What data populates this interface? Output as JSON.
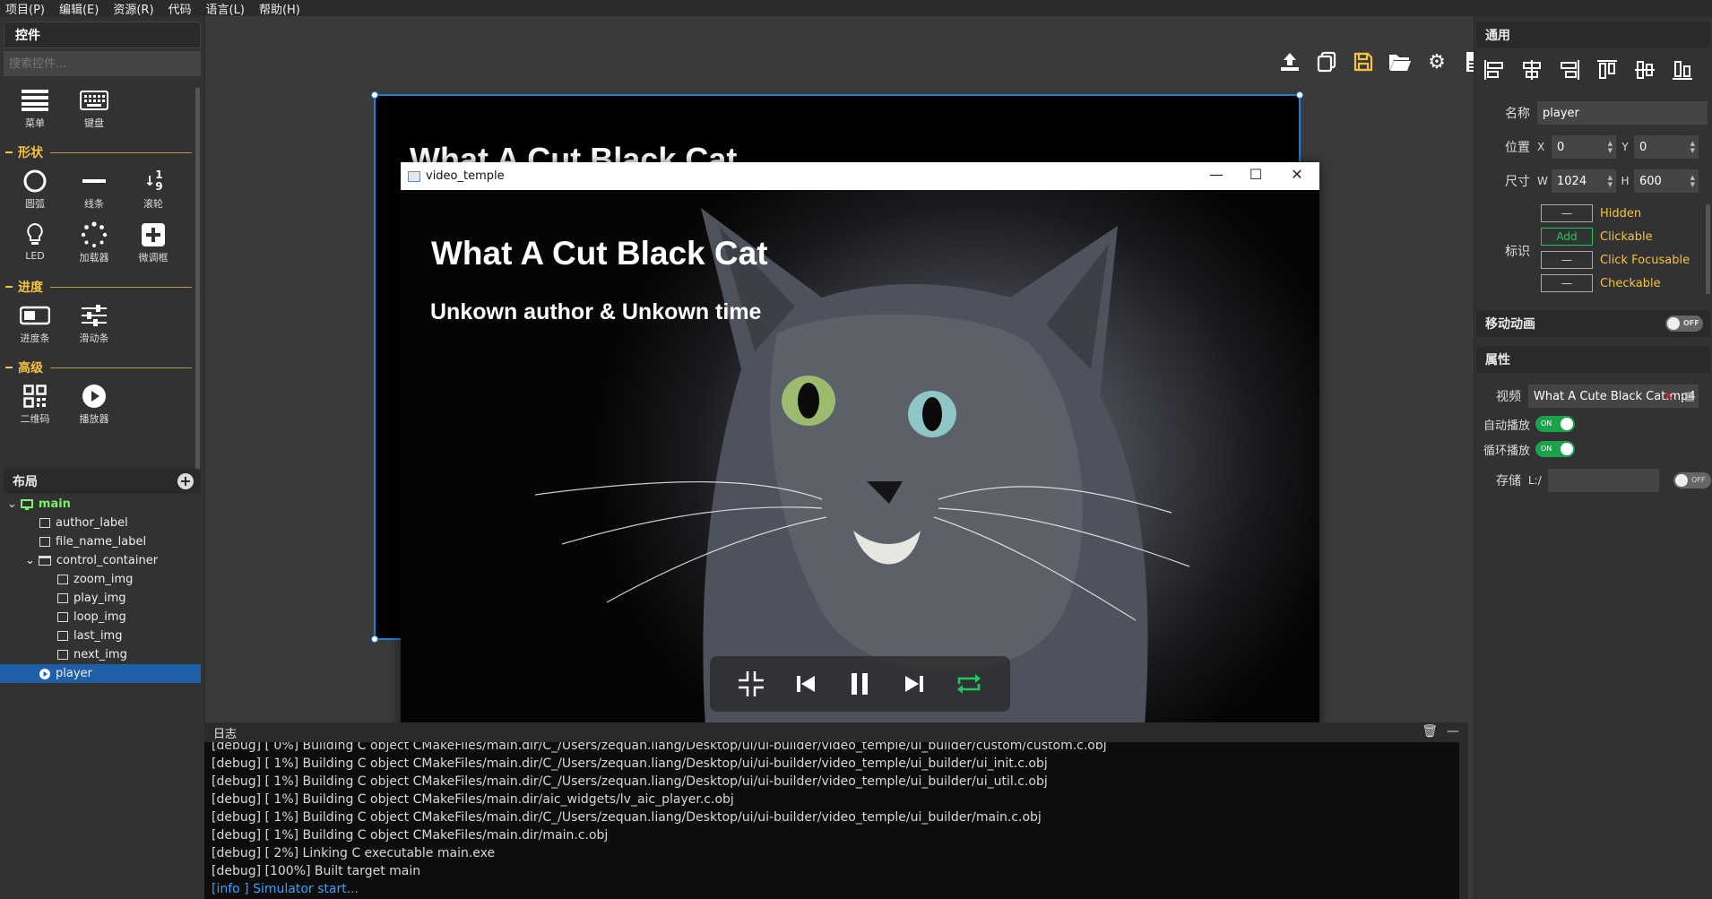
{
  "menu": [
    "项目(P)",
    "编辑(E)",
    "资源(R)",
    "代码",
    "语言(L)",
    "帮助(H)"
  ],
  "left": {
    "controls_title": "控件",
    "search_placeholder": "搜索控件...",
    "basic": [
      {
        "label": "菜单",
        "icon": "menu-icon"
      },
      {
        "label": "键盘",
        "icon": "keyboard-icon"
      }
    ],
    "shapes_title": "形状",
    "shapes": [
      {
        "label": "圆弧",
        "icon": "arc-icon"
      },
      {
        "label": "线条",
        "icon": "line-icon"
      },
      {
        "label": "滚轮",
        "icon": "roller-icon"
      },
      {
        "label": "LED",
        "icon": "led-icon"
      },
      {
        "label": "加载器",
        "icon": "spinner-icon"
      },
      {
        "label": "微调框",
        "icon": "spinbox-icon"
      }
    ],
    "progress_title": "进度",
    "progress": [
      {
        "label": "进度条",
        "icon": "progress-bar-icon"
      },
      {
        "label": "滑动条",
        "icon": "slider-icon"
      }
    ],
    "advanced_title": "高级",
    "advanced": [
      {
        "label": "二维码",
        "icon": "qrcode-icon"
      },
      {
        "label": "播放器",
        "icon": "player-icon"
      }
    ],
    "roller_glyph": "1 9"
  },
  "layout": {
    "title": "布局",
    "tree": [
      {
        "label": "main",
        "depth": 0,
        "type": "screen"
      },
      {
        "label": "author_label",
        "depth": 1,
        "type": "label"
      },
      {
        "label": "file_name_label",
        "depth": 1,
        "type": "label"
      },
      {
        "label": "control_container",
        "depth": 1,
        "type": "container"
      },
      {
        "label": "zoom_img",
        "depth": 2,
        "type": "image"
      },
      {
        "label": "play_img",
        "depth": 2,
        "type": "image"
      },
      {
        "label": "loop_img",
        "depth": 2,
        "type": "image"
      },
      {
        "label": "last_img",
        "depth": 2,
        "type": "image"
      },
      {
        "label": "next_img",
        "depth": 2,
        "type": "image"
      },
      {
        "label": "player",
        "depth": 1,
        "type": "player",
        "selected": true
      }
    ]
  },
  "toolbar": {
    "marker": "1",
    "buttons": [
      "export-icon",
      "copy-icon",
      "save-icon",
      "open-folder-icon",
      "settings-icon",
      "document-icon",
      "undo-icon",
      "redo-icon",
      "code-icon",
      "clean-icon",
      "run-icon"
    ]
  },
  "design": {
    "title": "What A Cut Black Cat"
  },
  "simulator": {
    "window_title": "video_temple",
    "video_title": "What A Cut Black Cat",
    "video_subtitle": "Unkown author & Unkown time",
    "loop_color": "#22c55e"
  },
  "log": {
    "title": "日志",
    "lines": [
      {
        "text": "[debug] [  0%] Building C object CMakeFiles/main.dir/C_/Users/zequan.liang/Desktop/ui/ui-builder/video_temple/ui_builder/custom/custom.c.obj",
        "level": "debug"
      },
      {
        "text": "[debug] [  1%] Building C object CMakeFiles/main.dir/C_/Users/zequan.liang/Desktop/ui/ui-builder/video_temple/ui_builder/ui_init.c.obj",
        "level": "debug"
      },
      {
        "text": "[debug] [  1%] Building C object CMakeFiles/main.dir/C_/Users/zequan.liang/Desktop/ui/ui-builder/video_temple/ui_builder/ui_util.c.obj",
        "level": "debug"
      },
      {
        "text": "[debug] [  1%] Building C object CMakeFiles/main.dir/aic_widgets/lv_aic_player.c.obj",
        "level": "debug"
      },
      {
        "text": "[debug] [  1%] Building C object CMakeFiles/main.dir/C_/Users/zequan.liang/Desktop/ui/ui-builder/video_temple/ui_builder/main.c.obj",
        "level": "debug"
      },
      {
        "text": "[debug] [  1%] Building C object CMakeFiles/main.dir/main.c.obj",
        "level": "debug"
      },
      {
        "text": "[debug] [  2%] Linking C executable main.exe",
        "level": "debug"
      },
      {
        "text": "[debug] [100%] Built target main",
        "level": "debug"
      },
      {
        "text": "[info ] Simulator start...",
        "level": "info"
      }
    ]
  },
  "right": {
    "general_title": "通用",
    "name_label": "名称",
    "name_value": "player",
    "pos_label": "位置",
    "x_label": "X",
    "x_value": "0",
    "y_label": "Y",
    "y_value": "0",
    "size_label": "尺寸",
    "w_label": "W",
    "w_value": "1024",
    "h_label": "H",
    "h_value": "600",
    "flags_label": "标识",
    "flags": [
      {
        "state": "—",
        "label": "Hidden",
        "active": false
      },
      {
        "state": "Add",
        "label": "Clickable",
        "active": true
      },
      {
        "state": "—",
        "label": "Click Focusable",
        "active": false
      },
      {
        "state": "—",
        "label": "Checkable",
        "active": false
      }
    ],
    "move_anim_title": "移动动画",
    "move_anim_state": "OFF",
    "props_title": "属性",
    "video_label": "视频",
    "video_value": "What A Cute Black Cat.mp4",
    "autoplay_label": "自动播放",
    "autoplay_state": "ON",
    "loop_label": "循环播放",
    "loop_state": "ON",
    "storage_label": "存储",
    "storage_prefix": "L:/",
    "storage_state": "OFF"
  }
}
